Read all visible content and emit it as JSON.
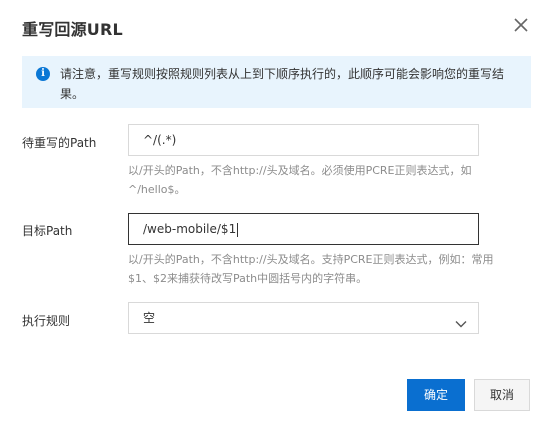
{
  "dialog": {
    "title": "重写回源URL",
    "notice": "请注意，重写规则按照规则列表从上到下顺序执行的，此顺序可能会影响您的重写结果。"
  },
  "form": {
    "source_path": {
      "label": "待重写的Path",
      "value": "^/(.*)",
      "help": "以/开头的Path，不含http://头及域名。必须使用PCRE正则表达式，如^/hello$。"
    },
    "target_path": {
      "label": "目标Path",
      "value": "/web-mobile/$1",
      "help": "以/开头的Path，不含http://头及域名。支持PCRE正则表达式，例如：常用$1、$2来捕获待改写Path中圆括号内的字符串。"
    },
    "rule": {
      "label": "执行规则",
      "value": "空"
    }
  },
  "footer": {
    "ok_label": "确定",
    "cancel_label": "取消"
  },
  "colors": {
    "primary": "#0a6fd0",
    "notice_bg": "#e8f4fd",
    "info_icon": "#0a77d5"
  }
}
